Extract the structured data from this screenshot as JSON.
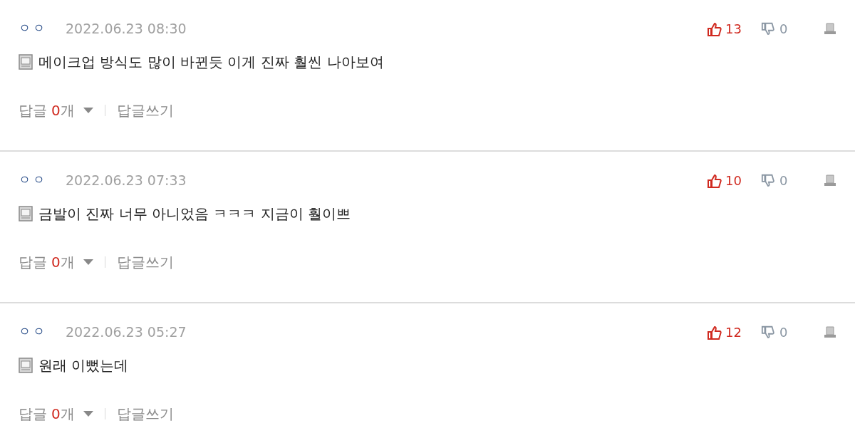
{
  "comments": [
    {
      "author": "ㅇㅇ",
      "date": "2022.06.23 08:30",
      "likes": "13",
      "dislikes": "0",
      "text": "메이크업 방식도 많이 바뀐듯 이게 진짜 훨씬 나아보여",
      "reply_label": "답글",
      "reply_count": "0",
      "reply_unit": "개",
      "write_reply": "답글쓰기"
    },
    {
      "author": "ㅇㅇ",
      "date": "2022.06.23 07:33",
      "likes": "10",
      "dislikes": "0",
      "text": "금발이 진짜 너무 아니었음 ㅋㅋㅋ 지금이 훨이쁘",
      "reply_label": "답글",
      "reply_count": "0",
      "reply_unit": "개",
      "write_reply": "답글쓰기"
    },
    {
      "author": "ㅇㅇ",
      "date": "2022.06.23 05:27",
      "likes": "12",
      "dislikes": "0",
      "text": "원래 이뻤는데",
      "reply_label": "답글",
      "reply_count": "0",
      "reply_unit": "개",
      "write_reply": "답글쓰기"
    }
  ]
}
